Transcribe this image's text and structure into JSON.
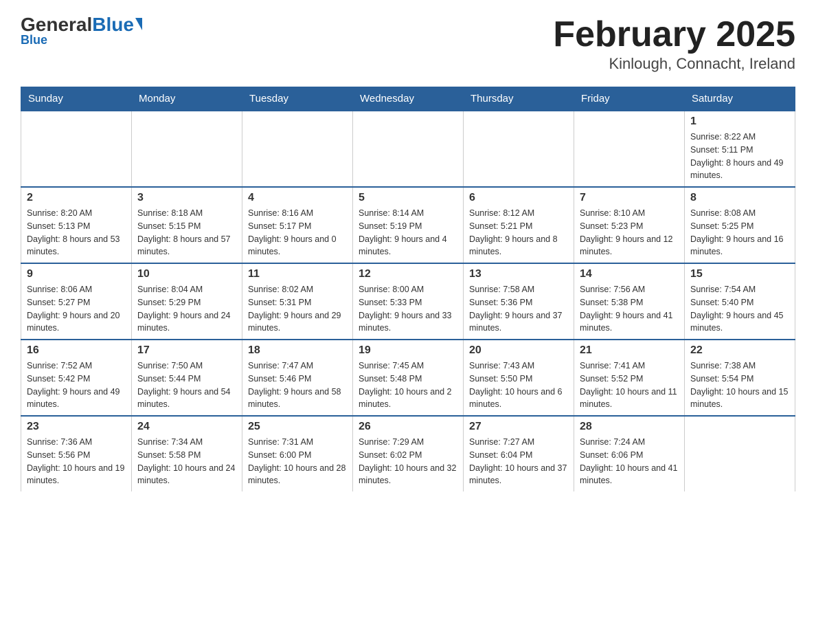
{
  "header": {
    "logo_general": "General",
    "logo_blue": "Blue",
    "title": "February 2025",
    "subtitle": "Kinlough, Connacht, Ireland"
  },
  "days": [
    "Sunday",
    "Monday",
    "Tuesday",
    "Wednesday",
    "Thursday",
    "Friday",
    "Saturday"
  ],
  "weeks": [
    [
      {
        "date": "",
        "info": ""
      },
      {
        "date": "",
        "info": ""
      },
      {
        "date": "",
        "info": ""
      },
      {
        "date": "",
        "info": ""
      },
      {
        "date": "",
        "info": ""
      },
      {
        "date": "",
        "info": ""
      },
      {
        "date": "1",
        "info": "Sunrise: 8:22 AM\nSunset: 5:11 PM\nDaylight: 8 hours and 49 minutes."
      }
    ],
    [
      {
        "date": "2",
        "info": "Sunrise: 8:20 AM\nSunset: 5:13 PM\nDaylight: 8 hours and 53 minutes."
      },
      {
        "date": "3",
        "info": "Sunrise: 8:18 AM\nSunset: 5:15 PM\nDaylight: 8 hours and 57 minutes."
      },
      {
        "date": "4",
        "info": "Sunrise: 8:16 AM\nSunset: 5:17 PM\nDaylight: 9 hours and 0 minutes."
      },
      {
        "date": "5",
        "info": "Sunrise: 8:14 AM\nSunset: 5:19 PM\nDaylight: 9 hours and 4 minutes."
      },
      {
        "date": "6",
        "info": "Sunrise: 8:12 AM\nSunset: 5:21 PM\nDaylight: 9 hours and 8 minutes."
      },
      {
        "date": "7",
        "info": "Sunrise: 8:10 AM\nSunset: 5:23 PM\nDaylight: 9 hours and 12 minutes."
      },
      {
        "date": "8",
        "info": "Sunrise: 8:08 AM\nSunset: 5:25 PM\nDaylight: 9 hours and 16 minutes."
      }
    ],
    [
      {
        "date": "9",
        "info": "Sunrise: 8:06 AM\nSunset: 5:27 PM\nDaylight: 9 hours and 20 minutes."
      },
      {
        "date": "10",
        "info": "Sunrise: 8:04 AM\nSunset: 5:29 PM\nDaylight: 9 hours and 24 minutes."
      },
      {
        "date": "11",
        "info": "Sunrise: 8:02 AM\nSunset: 5:31 PM\nDaylight: 9 hours and 29 minutes."
      },
      {
        "date": "12",
        "info": "Sunrise: 8:00 AM\nSunset: 5:33 PM\nDaylight: 9 hours and 33 minutes."
      },
      {
        "date": "13",
        "info": "Sunrise: 7:58 AM\nSunset: 5:36 PM\nDaylight: 9 hours and 37 minutes."
      },
      {
        "date": "14",
        "info": "Sunrise: 7:56 AM\nSunset: 5:38 PM\nDaylight: 9 hours and 41 minutes."
      },
      {
        "date": "15",
        "info": "Sunrise: 7:54 AM\nSunset: 5:40 PM\nDaylight: 9 hours and 45 minutes."
      }
    ],
    [
      {
        "date": "16",
        "info": "Sunrise: 7:52 AM\nSunset: 5:42 PM\nDaylight: 9 hours and 49 minutes."
      },
      {
        "date": "17",
        "info": "Sunrise: 7:50 AM\nSunset: 5:44 PM\nDaylight: 9 hours and 54 minutes."
      },
      {
        "date": "18",
        "info": "Sunrise: 7:47 AM\nSunset: 5:46 PM\nDaylight: 9 hours and 58 minutes."
      },
      {
        "date": "19",
        "info": "Sunrise: 7:45 AM\nSunset: 5:48 PM\nDaylight: 10 hours and 2 minutes."
      },
      {
        "date": "20",
        "info": "Sunrise: 7:43 AM\nSunset: 5:50 PM\nDaylight: 10 hours and 6 minutes."
      },
      {
        "date": "21",
        "info": "Sunrise: 7:41 AM\nSunset: 5:52 PM\nDaylight: 10 hours and 11 minutes."
      },
      {
        "date": "22",
        "info": "Sunrise: 7:38 AM\nSunset: 5:54 PM\nDaylight: 10 hours and 15 minutes."
      }
    ],
    [
      {
        "date": "23",
        "info": "Sunrise: 7:36 AM\nSunset: 5:56 PM\nDaylight: 10 hours and 19 minutes."
      },
      {
        "date": "24",
        "info": "Sunrise: 7:34 AM\nSunset: 5:58 PM\nDaylight: 10 hours and 24 minutes."
      },
      {
        "date": "25",
        "info": "Sunrise: 7:31 AM\nSunset: 6:00 PM\nDaylight: 10 hours and 28 minutes."
      },
      {
        "date": "26",
        "info": "Sunrise: 7:29 AM\nSunset: 6:02 PM\nDaylight: 10 hours and 32 minutes."
      },
      {
        "date": "27",
        "info": "Sunrise: 7:27 AM\nSunset: 6:04 PM\nDaylight: 10 hours and 37 minutes."
      },
      {
        "date": "28",
        "info": "Sunrise: 7:24 AM\nSunset: 6:06 PM\nDaylight: 10 hours and 41 minutes."
      },
      {
        "date": "",
        "info": ""
      }
    ]
  ]
}
